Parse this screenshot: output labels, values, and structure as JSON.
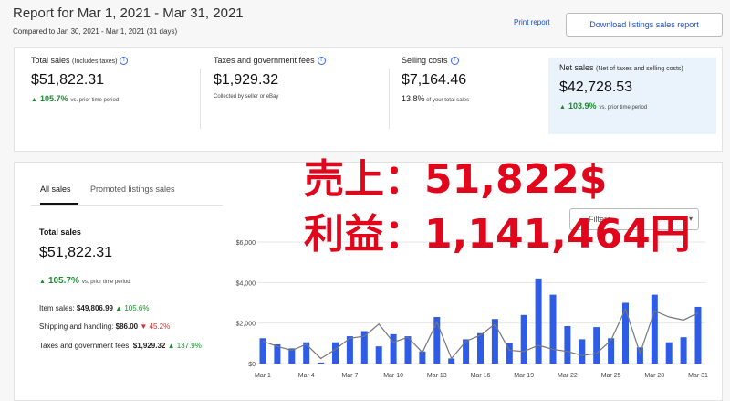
{
  "header": {
    "title": "Report for Mar 1, 2021 - Mar 31, 2021",
    "subtitle": "Compared to Jan 30, 2021 - Mar 1, 2021 (31 days)",
    "print_link": "Print report",
    "download_button": "Download listings sales report"
  },
  "summary": {
    "total_sales": {
      "label": "Total sales",
      "label_note": "(Includes taxes)",
      "value": "$51,822.31",
      "delta": "105.7%",
      "delta_note": "vs. prior time period"
    },
    "taxes": {
      "label": "Taxes and government fees",
      "value": "$1,929.32",
      "note": "Collected by seller or eBay"
    },
    "selling_costs": {
      "label": "Selling costs",
      "value": "$7,164.46",
      "pct": "13.8%",
      "note": "of your total sales"
    },
    "net_sales": {
      "label": "Net sales",
      "label_note": "(Net of taxes and selling costs)",
      "value": "$42,728.53",
      "delta": "103.9%",
      "delta_note": "vs. prior time period"
    }
  },
  "tabs": [
    {
      "label": "All sales"
    },
    {
      "label": "Promoted listings sales"
    }
  ],
  "detail": {
    "title": "Total sales",
    "value": "$51,822.31",
    "delta": "105.7%",
    "delta_note": "vs. prior time period",
    "breakdown": [
      {
        "label": "Item sales:",
        "value": "$49,806.99",
        "delta": "105.6%",
        "direction": "up"
      },
      {
        "label": "Shipping and handling:",
        "value": "$86.00",
        "delta": "45.2%",
        "direction": "down"
      },
      {
        "label": "Taxes and government fees:",
        "value": "$1,929.32",
        "delta": "137.9%",
        "direction": "up"
      }
    ]
  },
  "filter": {
    "label": "Filters"
  },
  "overlay": {
    "line1": "売上：51,822$",
    "line2": "利益：1,141,464円"
  },
  "colors": {
    "accent": "#3665f3",
    "positive": "#1c8a2e",
    "negative": "#d62c2c",
    "overlay": "#e0061b",
    "bar": "#2e5ce6",
    "line": "#777777"
  },
  "chart_data": {
    "type": "bar",
    "x": [
      "Mar 1",
      "Mar 2",
      "Mar 3",
      "Mar 4",
      "Mar 5",
      "Mar 6",
      "Mar 7",
      "Mar 8",
      "Mar 9",
      "Mar 10",
      "Mar 11",
      "Mar 12",
      "Mar 13",
      "Mar 14",
      "Mar 15",
      "Mar 16",
      "Mar 17",
      "Mar 18",
      "Mar 19",
      "Mar 20",
      "Mar 21",
      "Mar 22",
      "Mar 23",
      "Mar 24",
      "Mar 25",
      "Mar 26",
      "Mar 27",
      "Mar 28",
      "Mar 29",
      "Mar 30",
      "Mar 31"
    ],
    "tick_labels": [
      "Mar 1",
      "Mar 4",
      "Mar 7",
      "Mar 10",
      "Mar 13",
      "Mar 16",
      "Mar 19",
      "Mar 22",
      "Mar 25",
      "Mar 28",
      "Mar 31"
    ],
    "yticks": [
      "$0",
      "$2,000",
      "$4,000",
      "$6,000"
    ],
    "ylim": [
      0,
      6000
    ],
    "series": [
      {
        "type": "bar",
        "values": [
          1250,
          950,
          750,
          1050,
          50,
          1050,
          1350,
          1600,
          850,
          1450,
          1350,
          600,
          2300,
          250,
          1200,
          1500,
          2200,
          1000,
          2400,
          4200,
          3400,
          1850,
          1200,
          1800,
          1250,
          3000,
          800,
          3400,
          1050,
          1300,
          2800
        ]
      },
      {
        "type": "line",
        "values": [
          1100,
          850,
          650,
          950,
          250,
          700,
          1250,
          1350,
          1950,
          1050,
          1300,
          550,
          2050,
          250,
          1100,
          1400,
          1950,
          650,
          600,
          900,
          700,
          600,
          400,
          500,
          1150,
          2700,
          500,
          2600,
          2300,
          2150,
          2500
        ]
      }
    ]
  }
}
